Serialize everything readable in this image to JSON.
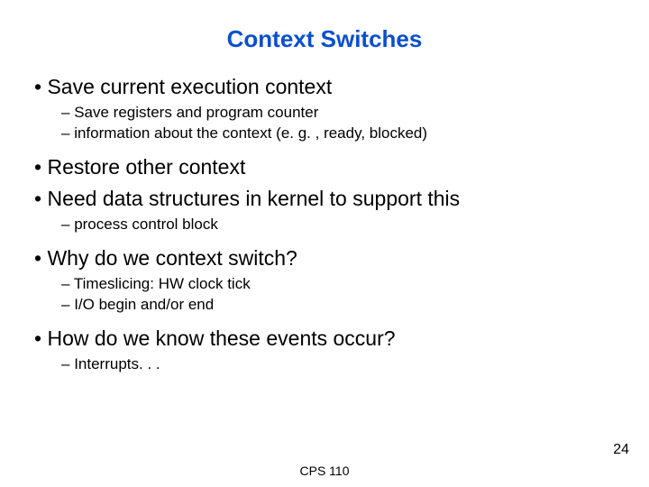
{
  "title": "Context Switches",
  "bullets": {
    "b0": "Save current execution context",
    "b0_s0": "Save  registers and program counter",
    "b0_s1": "information about the context (e. g. , ready, blocked)",
    "b1": "Restore other context",
    "b2": "Need data structures in kernel to support this",
    "b2_s0": "process control block",
    "b3": "Why do we context switch?",
    "b3_s0": "Timeslicing: HW clock tick",
    "b3_s1": "I/O begin and/or end",
    "b4": "How do we know these events occur?",
    "b4_s0": "Interrupts. . ."
  },
  "footer": {
    "center": "CPS 110",
    "pagenum": "24"
  }
}
